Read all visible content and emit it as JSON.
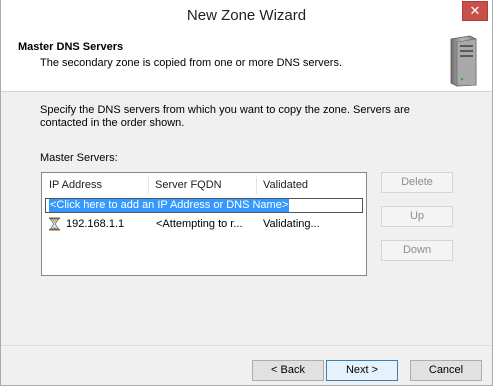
{
  "window": {
    "title": "New Zone Wizard",
    "close_glyph": "✕"
  },
  "header": {
    "title": "Master DNS Servers",
    "subtitle": "The secondary zone is copied from one or more DNS servers.",
    "icon": "server-icon"
  },
  "body": {
    "instructions": "Specify the DNS servers from which you want to copy the zone.  Servers are contacted in the order shown.",
    "master_label": "Master Servers:"
  },
  "list": {
    "columns": [
      "IP Address",
      "Server FQDN",
      "Validated"
    ],
    "add_prompt": "<Click here to add an IP Address or DNS Name>",
    "rows": [
      {
        "icon": "hourglass-icon",
        "ip": "192.168.1.1",
        "fqdn": "<Attempting to r...",
        "validated": "Validating..."
      }
    ]
  },
  "side_buttons": {
    "delete": "Delete",
    "up": "Up",
    "down": "Down"
  },
  "footer": {
    "back": "< Back",
    "next": "Next >",
    "cancel": "Cancel"
  }
}
